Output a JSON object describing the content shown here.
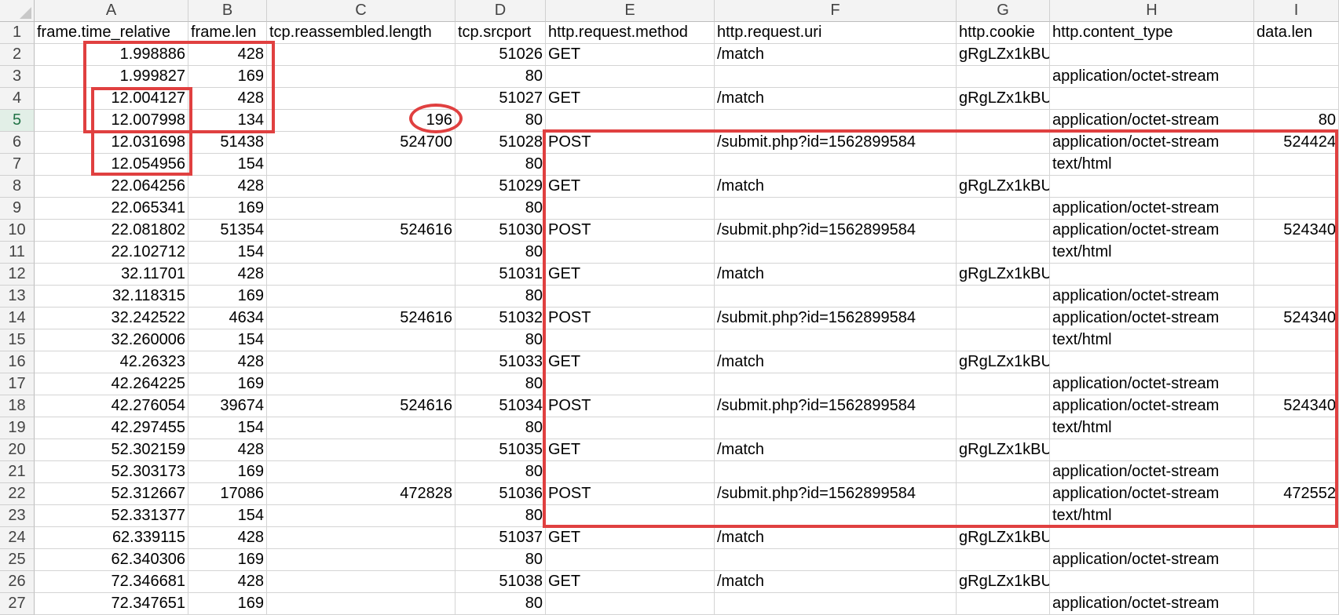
{
  "columns": [
    {
      "letter": "A",
      "header": "frame.time_relative",
      "align": "num"
    },
    {
      "letter": "B",
      "header": "frame.len",
      "align": "num"
    },
    {
      "letter": "C",
      "header": "tcp.reassembled.length",
      "align": "num"
    },
    {
      "letter": "D",
      "header": "tcp.srcport",
      "align": "num"
    },
    {
      "letter": "E",
      "header": "http.request.method",
      "align": "txt"
    },
    {
      "letter": "F",
      "header": "http.request.uri",
      "align": "txt"
    },
    {
      "letter": "G",
      "header": "http.cookie",
      "align": "txt"
    },
    {
      "letter": "H",
      "header": "http.content_type",
      "align": "txt"
    },
    {
      "letter": "I",
      "header": "data.len",
      "align": "num"
    }
  ],
  "row_numbers": [
    "1",
    "2",
    "3",
    "4",
    "5",
    "6",
    "7",
    "8",
    "9",
    "10",
    "11",
    "12",
    "13",
    "14",
    "15",
    "16",
    "17",
    "18",
    "19",
    "20",
    "21",
    "22",
    "23",
    "24",
    "25",
    "26",
    "27"
  ],
  "selected_row": "5",
  "rows": [
    [
      "1.998886",
      "428",
      "",
      "51026",
      "GET",
      "/match",
      "gRgLZx1kBU",
      "",
      ""
    ],
    [
      "1.999827",
      "169",
      "",
      "80",
      "",
      "",
      "",
      "application/octet-stream",
      ""
    ],
    [
      "12.004127",
      "428",
      "",
      "51027",
      "GET",
      "/match",
      "gRgLZx1kBU",
      "",
      ""
    ],
    [
      "12.007998",
      "134",
      "196",
      "80",
      "",
      "",
      "",
      "application/octet-stream",
      "80"
    ],
    [
      "12.031698",
      "51438",
      "524700",
      "51028",
      "POST",
      "/submit.php?id=1562899584",
      "",
      "application/octet-stream",
      "524424"
    ],
    [
      "12.054956",
      "154",
      "",
      "80",
      "",
      "",
      "",
      "text/html",
      ""
    ],
    [
      "22.064256",
      "428",
      "",
      "51029",
      "GET",
      "/match",
      "gRgLZx1kBU",
      "",
      ""
    ],
    [
      "22.065341",
      "169",
      "",
      "80",
      "",
      "",
      "",
      "application/octet-stream",
      ""
    ],
    [
      "22.081802",
      "51354",
      "524616",
      "51030",
      "POST",
      "/submit.php?id=1562899584",
      "",
      "application/octet-stream",
      "524340"
    ],
    [
      "22.102712",
      "154",
      "",
      "80",
      "",
      "",
      "",
      "text/html",
      ""
    ],
    [
      "32.11701",
      "428",
      "",
      "51031",
      "GET",
      "/match",
      "gRgLZx1kBU",
      "",
      ""
    ],
    [
      "32.118315",
      "169",
      "",
      "80",
      "",
      "",
      "",
      "application/octet-stream",
      ""
    ],
    [
      "32.242522",
      "4634",
      "524616",
      "51032",
      "POST",
      "/submit.php?id=1562899584",
      "",
      "application/octet-stream",
      "524340"
    ],
    [
      "32.260006",
      "154",
      "",
      "80",
      "",
      "",
      "",
      "text/html",
      ""
    ],
    [
      "42.26323",
      "428",
      "",
      "51033",
      "GET",
      "/match",
      "gRgLZx1kBU",
      "",
      ""
    ],
    [
      "42.264225",
      "169",
      "",
      "80",
      "",
      "",
      "",
      "application/octet-stream",
      ""
    ],
    [
      "42.276054",
      "39674",
      "524616",
      "51034",
      "POST",
      "/submit.php?id=1562899584",
      "",
      "application/octet-stream",
      "524340"
    ],
    [
      "42.297455",
      "154",
      "",
      "80",
      "",
      "",
      "",
      "text/html",
      ""
    ],
    [
      "52.302159",
      "428",
      "",
      "51035",
      "GET",
      "/match",
      "gRgLZx1kBU",
      "",
      ""
    ],
    [
      "52.303173",
      "169",
      "",
      "80",
      "",
      "",
      "",
      "application/octet-stream",
      ""
    ],
    [
      "52.312667",
      "17086",
      "472828",
      "51036",
      "POST",
      "/submit.php?id=1562899584",
      "",
      "application/octet-stream",
      "472552"
    ],
    [
      "52.331377",
      "154",
      "",
      "80",
      "",
      "",
      "",
      "text/html",
      ""
    ],
    [
      "62.339115",
      "428",
      "",
      "51037",
      "GET",
      "/match",
      "gRgLZx1kBU",
      "",
      ""
    ],
    [
      "62.340306",
      "169",
      "",
      "80",
      "",
      "",
      "",
      "application/octet-stream",
      ""
    ],
    [
      "72.346681",
      "428",
      "",
      "51038",
      "GET",
      "/match",
      "gRgLZx1kBU",
      "",
      ""
    ],
    [
      "72.347651",
      "169",
      "",
      "80",
      "",
      "",
      "",
      "application/octet-stream",
      ""
    ]
  ],
  "colors": {
    "annotation": "#e04040",
    "selected_row_header": "#217346"
  }
}
